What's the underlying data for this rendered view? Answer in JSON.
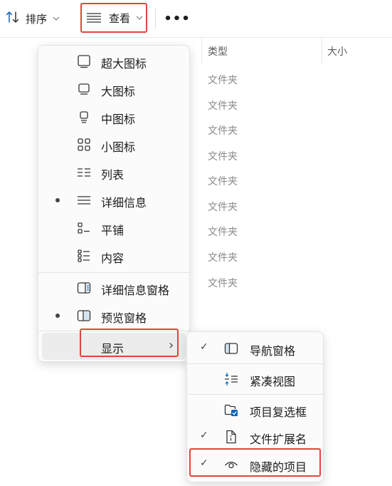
{
  "toolbar": {
    "sort_label": "排序",
    "view_label": "查看",
    "more_label": "•••"
  },
  "file_list": {
    "col_type": "类型",
    "col_size": "大小",
    "rows": [
      "文件夹",
      "文件夹",
      "文件夹",
      "文件夹",
      "文件夹",
      "文件夹",
      "文件夹",
      "文件夹",
      "文件夹"
    ]
  },
  "view_menu": {
    "items": [
      {
        "label": "超大图标",
        "icon": "monitor-xl-icon",
        "selected": false
      },
      {
        "label": "大图标",
        "icon": "monitor-large-icon",
        "selected": false
      },
      {
        "label": "中图标",
        "icon": "monitor-medium-icon",
        "selected": false
      },
      {
        "label": "小图标",
        "icon": "small-icons-grid-icon",
        "selected": false
      },
      {
        "label": "列表",
        "icon": "list-view-icon",
        "selected": false
      },
      {
        "label": "详细信息",
        "icon": "details-view-icon",
        "selected": true
      },
      {
        "label": "平铺",
        "icon": "tiles-view-icon",
        "selected": false
      },
      {
        "label": "内容",
        "icon": "content-view-icon",
        "selected": false
      }
    ],
    "panes": [
      {
        "label": "详细信息窗格",
        "icon": "details-pane-icon",
        "selected": false
      },
      {
        "label": "预览窗格",
        "icon": "preview-pane-icon",
        "selected": true
      }
    ],
    "show_label": "显示",
    "show_chevron": "›"
  },
  "show_submenu": {
    "items": [
      {
        "label": "导航窗格",
        "icon": "navigation-pane-icon",
        "checked": true
      },
      {
        "label": "紧凑视图",
        "icon": "compact-view-icon",
        "checked": false
      },
      {
        "label": "项目复选框",
        "icon": "item-checkbox-icon",
        "checked": false
      },
      {
        "label": "文件扩展名",
        "icon": "file-extension-icon",
        "checked": true
      },
      {
        "label": "隐藏的项目",
        "icon": "eye-icon",
        "checked": true
      }
    ],
    "check_glyph": "✓"
  },
  "colors": {
    "highlight_border": "#e0463b",
    "accent_blue": "#0067c0",
    "menu_bg": "#fbfbfb"
  }
}
